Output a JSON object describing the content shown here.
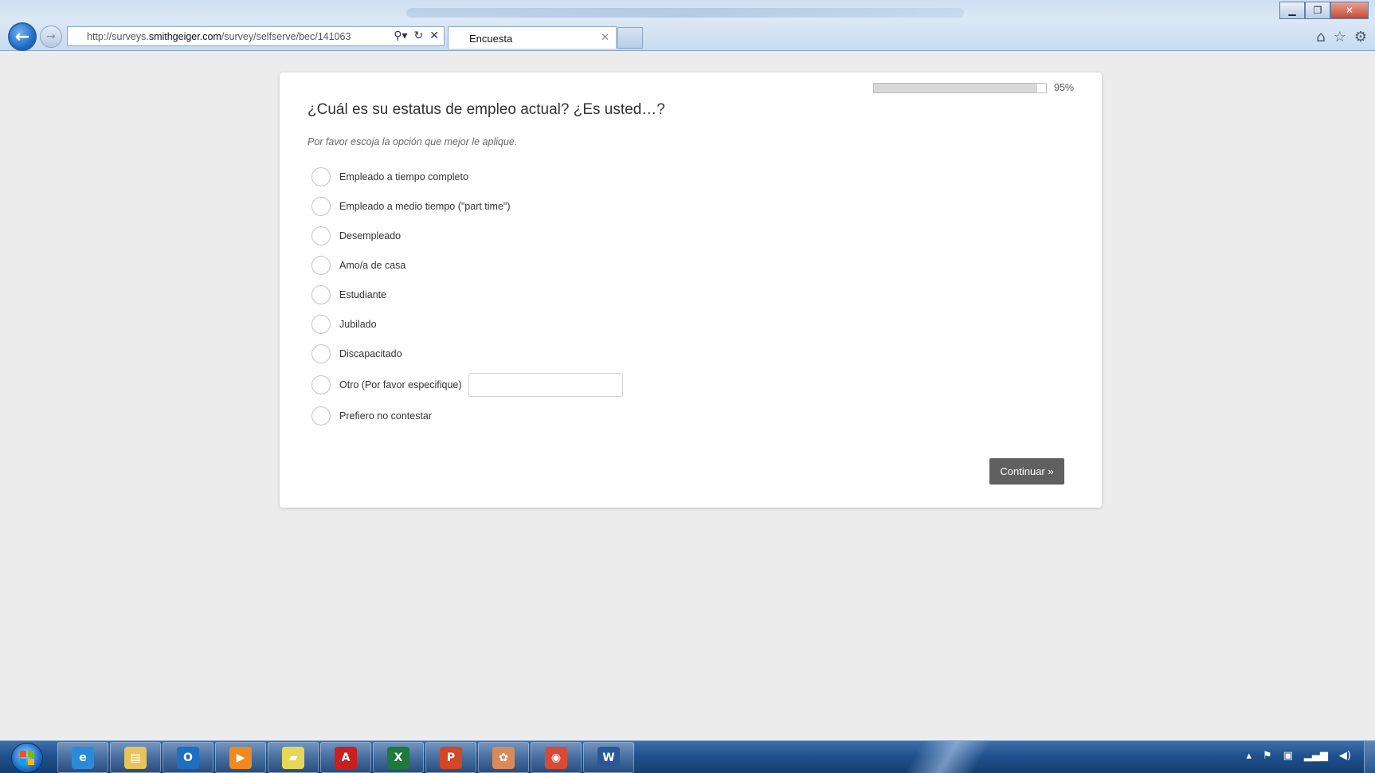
{
  "browser": {
    "url_prefix": "http://surveys.",
    "url_domain": "smithgeiger.com",
    "url_path": "/survey/selfserve/bec/141063",
    "tab_title": "Encuesta",
    "icons": {
      "back": "back-arrow-icon",
      "forward": "forward-arrow-icon",
      "search": "search-icon",
      "refresh": "refresh-icon",
      "stop": "stop-icon",
      "home": "home-icon",
      "favorites": "star-icon",
      "tools": "gear-icon"
    }
  },
  "survey": {
    "progress_value": 0.95,
    "progress_text": "95%",
    "question": "¿Cuál es su estatus de empleo actual? ¿Es usted…?",
    "instruction": "Por favor escoja la opción que mejor le aplique.",
    "options": [
      "Empleado a tiempo completo",
      "Empleado a medio tiempo (\"part time\")",
      "Desempleado",
      "Amo/a de casa",
      "Estudiante",
      "Jubilado",
      "Discapacitado",
      "Otro (Por favor especifique)",
      "Prefiero no contestar"
    ],
    "other_input_value": "",
    "continue_label": "Continuar »"
  },
  "taskbar": {
    "apps": [
      {
        "name": "internet-explorer-icon",
        "glyph": "e",
        "color": "#2a8ad8"
      },
      {
        "name": "file-explorer-icon",
        "glyph": "▤",
        "color": "#e8c35a"
      },
      {
        "name": "outlook-icon",
        "glyph": "O",
        "color": "#1e6fc2"
      },
      {
        "name": "media-player-icon",
        "glyph": "▶",
        "color": "#f08a1c"
      },
      {
        "name": "sticky-notes-icon",
        "glyph": "▰",
        "color": "#e6d75a"
      },
      {
        "name": "adobe-acrobat-icon",
        "glyph": "A",
        "color": "#c8201e"
      },
      {
        "name": "excel-icon",
        "glyph": "X",
        "color": "#1e7a3c"
      },
      {
        "name": "powerpoint-icon",
        "glyph": "P",
        "color": "#d24726"
      },
      {
        "name": "paint-icon",
        "glyph": "✿",
        "color": "#d98a5a"
      },
      {
        "name": "chrome-icon",
        "glyph": "◉",
        "color": "#d84a38"
      },
      {
        "name": "word-icon",
        "glyph": "W",
        "color": "#2b5797"
      }
    ],
    "tray_icons": [
      "show-hidden-icon",
      "flag-icon",
      "network-icon",
      "signal-icon",
      "volume-icon"
    ]
  }
}
